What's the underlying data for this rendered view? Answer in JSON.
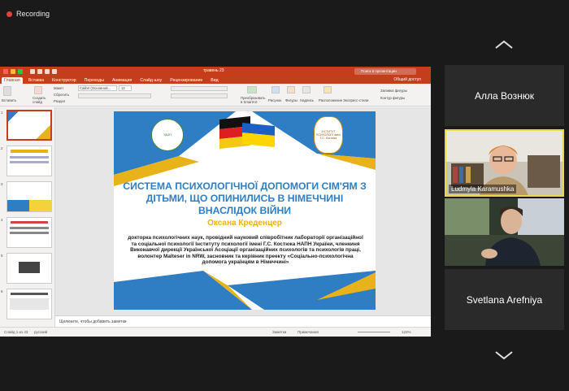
{
  "recording": {
    "label": "Recording"
  },
  "participants": [
    {
      "name": "Алла Вознюк"
    },
    {
      "name": "Ludmyla Karamushka"
    },
    {
      "name": "Svetlana Arefniya"
    }
  ],
  "ppt": {
    "file_title": "травень 23",
    "search_placeholder": "Поиск в презентации",
    "share_label": "Общий доступ",
    "tabs": [
      "Главная",
      "Вставка",
      "Конструктор",
      "Переходы",
      "Анимация",
      "Слайд-шоу",
      "Рецензирование",
      "Вид"
    ],
    "ribbon": {
      "paste": "Вставить",
      "new_slide": "Создать слайд",
      "layout": "Макет",
      "reset": "Сбросить",
      "section": "Раздел",
      "font": "Calibri (Основной...",
      "font_size": "12",
      "convert": "Преобразовать в SmartArt",
      "picture": "Рисунок",
      "shapes": "Фигуры",
      "textbox": "Надпись",
      "arrange": "Расположение",
      "quick_styles": "Экспресс-стили",
      "fill": "Заливка фигуры",
      "outline": "Контур фигуры"
    },
    "notes_placeholder": "Щелкните, чтобы добавить заметки",
    "status": {
      "slide": "Слайд 1 из 43",
      "language": "русский",
      "notes": "Заметки",
      "comments": "Примечания",
      "zoom": "122%"
    },
    "thumbnails": [
      {
        "num": "1"
      },
      {
        "num": "2"
      },
      {
        "num": "3"
      },
      {
        "num": "4"
      },
      {
        "num": "5"
      },
      {
        "num": "6"
      }
    ],
    "slide": {
      "title": "СИСТЕМА ПСИХОЛОГІЧНОЇ ДОПОМОГИ СІМ'ЯМ З ДІТЬМИ, ЩО ОПИНИЛИСЬ В НІМЕЧЧИНІ ВНАСЛІДОК ВІЙНИ",
      "author": "Оксана Креденцер",
      "bio": "докторка психологічних наук, провідний науковий співробітник лабораторії організаційної та соціальної психології Інституту психології імені Г.С. Костюка НАПН України, членкиня Виконавчої дирекції Української Асоціації організаційних психологів та психологів праці, волонтер Malteser in NRW, засновник та керівник преекту «Соціально-психологічна допомога українцям в Німеччині»",
      "logo_left": "УАОП",
      "logo_right": "ІНСТИТУТ ПСИХОЛОГІЇ імені Г.С. Костюка"
    }
  },
  "colors": {
    "ppt_accent": "#c43e1c",
    "slide_blue": "#2f7ec4",
    "slide_gold": "#e8b21a",
    "active_speaker": "#e8d84b"
  }
}
